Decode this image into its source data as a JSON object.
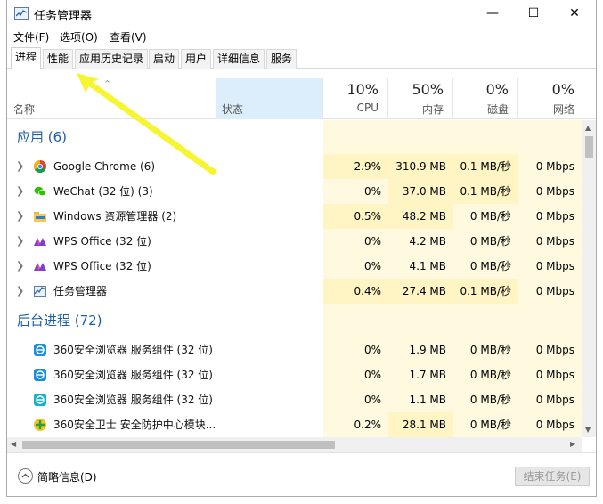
{
  "window": {
    "title": "任务管理器"
  },
  "menu": [
    "文件(F)",
    "选项(O)",
    "查看(V)"
  ],
  "tabs": [
    "进程",
    "性能",
    "应用历史记录",
    "启动",
    "用户",
    "详细信息",
    "服务"
  ],
  "header": {
    "name": "名称",
    "status": "状态",
    "cpu": {
      "pct": "10%",
      "label": "CPU"
    },
    "mem": {
      "pct": "50%",
      "label": "内存"
    },
    "disk": {
      "pct": "0%",
      "label": "磁盘"
    },
    "net": {
      "pct": "0%",
      "label": "网络"
    }
  },
  "groups": {
    "apps": "应用 (6)",
    "background": "后台进程 (72)"
  },
  "apps": [
    {
      "name": "Google Chrome (6)",
      "icon": "chrome-icon",
      "cpu": "2.9%",
      "mem": "310.9 MB",
      "disk": "0.1 MB/秒",
      "net": "0 Mbps"
    },
    {
      "name": "WeChat (32 位) (3)",
      "icon": "wechat-icon",
      "cpu": "0%",
      "mem": "37.0 MB",
      "disk": "0.1 MB/秒",
      "net": "0 Mbps"
    },
    {
      "name": "Windows 资源管理器 (2)",
      "icon": "folder-icon",
      "cpu": "0.5%",
      "mem": "48.2 MB",
      "disk": "0 MB/秒",
      "net": "0 Mbps"
    },
    {
      "name": "WPS Office (32 位)",
      "icon": "wps-icon",
      "cpu": "0%",
      "mem": "4.2 MB",
      "disk": "0 MB/秒",
      "net": "0 Mbps"
    },
    {
      "name": "WPS Office (32 位)",
      "icon": "wps-icon",
      "cpu": "0%",
      "mem": "4.1 MB",
      "disk": "0 MB/秒",
      "net": "0 Mbps"
    },
    {
      "name": "任务管理器",
      "icon": "task-manager-icon",
      "cpu": "0.4%",
      "mem": "27.4 MB",
      "disk": "0.1 MB/秒",
      "net": "0 Mbps"
    }
  ],
  "background": [
    {
      "name": "360安全浏览器 服务组件 (32 位)",
      "icon": "360-browser-icon",
      "cpu": "0%",
      "mem": "1.9 MB",
      "disk": "0 MB/秒",
      "net": "0 Mbps"
    },
    {
      "name": "360安全浏览器 服务组件 (32 位)",
      "icon": "360-browser-icon",
      "cpu": "0%",
      "mem": "1.7 MB",
      "disk": "0 MB/秒",
      "net": "0 Mbps"
    },
    {
      "name": "360安全浏览器 服务组件 (32 位)",
      "icon": "360-browser-icon",
      "cpu": "0%",
      "mem": "1.1 MB",
      "disk": "0 MB/秒",
      "net": "0 Mbps"
    },
    {
      "name": "360安全卫士 安全防护中心模块...",
      "icon": "360-guard-icon",
      "cpu": "0.2%",
      "mem": "28.1 MB",
      "disk": "0 MB/秒",
      "net": "0 Mbps"
    }
  ],
  "footer": {
    "fewer_details": "简略信息(D)",
    "end_task": "结束任务(E)"
  },
  "colors": {
    "accent": "#1e5fa8",
    "heat_strong": "#fff4c4",
    "heat_light": "#fff9e0",
    "annotation_arrow": "#f5f532"
  }
}
